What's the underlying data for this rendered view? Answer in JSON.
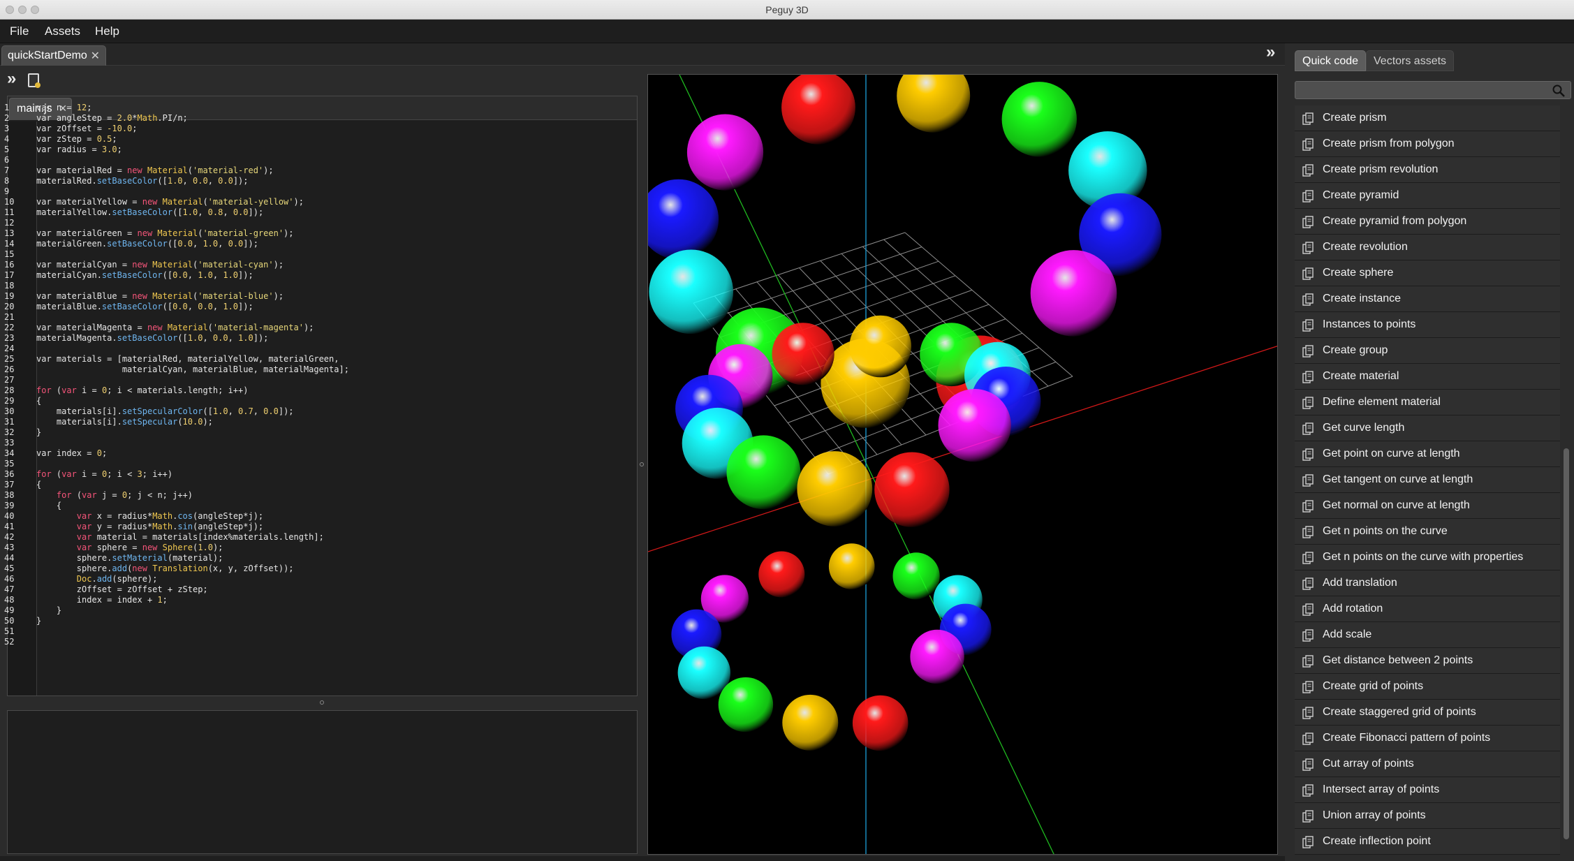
{
  "window": {
    "title": "Peguy 3D"
  },
  "menu": [
    "File",
    "Assets",
    "Help"
  ],
  "document_tab": {
    "label": "quickStartDemo",
    "close": "✕"
  },
  "editor": {
    "file_tab": {
      "label": "main.js",
      "close": "✕"
    },
    "line_count": 52,
    "lines": [
      [
        [
          "t",
          "var n = "
        ],
        [
          "n",
          "12"
        ],
        [
          "t",
          ";"
        ]
      ],
      [
        [
          "t",
          "var angleStep = "
        ],
        [
          "n",
          "2.0"
        ],
        [
          "t",
          "*"
        ],
        [
          "c",
          "Math"
        ],
        [
          "t",
          ".PI/n;"
        ]
      ],
      [
        [
          "t",
          "var zOffset = "
        ],
        [
          "n",
          "-10.0"
        ],
        [
          "t",
          ";"
        ]
      ],
      [
        [
          "t",
          "var zStep = "
        ],
        [
          "n",
          "0.5"
        ],
        [
          "t",
          ";"
        ]
      ],
      [
        [
          "t",
          "var radius = "
        ],
        [
          "n",
          "3.0"
        ],
        [
          "t",
          ";"
        ]
      ],
      [],
      [
        [
          "t",
          "var materialRed = "
        ],
        [
          "k",
          "new"
        ],
        [
          "t",
          " "
        ],
        [
          "c",
          "Material"
        ],
        [
          "t",
          "("
        ],
        [
          "s",
          "'material-red'"
        ],
        [
          "t",
          ");"
        ]
      ],
      [
        [
          "t",
          "materialRed."
        ],
        [
          "f",
          "setBaseColor"
        ],
        [
          "t",
          "(["
        ],
        [
          "n",
          "1.0"
        ],
        [
          "t",
          ", "
        ],
        [
          "n",
          "0.0"
        ],
        [
          "t",
          ", "
        ],
        [
          "n",
          "0.0"
        ],
        [
          "t",
          "]);"
        ]
      ],
      [],
      [
        [
          "t",
          "var materialYellow = "
        ],
        [
          "k",
          "new"
        ],
        [
          "t",
          " "
        ],
        [
          "c",
          "Material"
        ],
        [
          "t",
          "("
        ],
        [
          "s",
          "'material-yellow'"
        ],
        [
          "t",
          ");"
        ]
      ],
      [
        [
          "t",
          "materialYellow."
        ],
        [
          "f",
          "setBaseColor"
        ],
        [
          "t",
          "(["
        ],
        [
          "n",
          "1.0"
        ],
        [
          "t",
          ", "
        ],
        [
          "n",
          "0.8"
        ],
        [
          "t",
          ", "
        ],
        [
          "n",
          "0.0"
        ],
        [
          "t",
          "]);"
        ]
      ],
      [],
      [
        [
          "t",
          "var materialGreen = "
        ],
        [
          "k",
          "new"
        ],
        [
          "t",
          " "
        ],
        [
          "c",
          "Material"
        ],
        [
          "t",
          "("
        ],
        [
          "s",
          "'material-green'"
        ],
        [
          "t",
          ");"
        ]
      ],
      [
        [
          "t",
          "materialGreen."
        ],
        [
          "f",
          "setBaseColor"
        ],
        [
          "t",
          "(["
        ],
        [
          "n",
          "0.0"
        ],
        [
          "t",
          ", "
        ],
        [
          "n",
          "1.0"
        ],
        [
          "t",
          ", "
        ],
        [
          "n",
          "0.0"
        ],
        [
          "t",
          "]);"
        ]
      ],
      [],
      [
        [
          "t",
          "var materialCyan = "
        ],
        [
          "k",
          "new"
        ],
        [
          "t",
          " "
        ],
        [
          "c",
          "Material"
        ],
        [
          "t",
          "("
        ],
        [
          "s",
          "'material-cyan'"
        ],
        [
          "t",
          ");"
        ]
      ],
      [
        [
          "t",
          "materialCyan."
        ],
        [
          "f",
          "setBaseColor"
        ],
        [
          "t",
          "(["
        ],
        [
          "n",
          "0.0"
        ],
        [
          "t",
          ", "
        ],
        [
          "n",
          "1.0"
        ],
        [
          "t",
          ", "
        ],
        [
          "n",
          "1.0"
        ],
        [
          "t",
          "]);"
        ]
      ],
      [],
      [
        [
          "t",
          "var materialBlue = "
        ],
        [
          "k",
          "new"
        ],
        [
          "t",
          " "
        ],
        [
          "c",
          "Material"
        ],
        [
          "t",
          "("
        ],
        [
          "s",
          "'material-blue'"
        ],
        [
          "t",
          ");"
        ]
      ],
      [
        [
          "t",
          "materialBlue."
        ],
        [
          "f",
          "setBaseColor"
        ],
        [
          "t",
          "(["
        ],
        [
          "n",
          "0.0"
        ],
        [
          "t",
          ", "
        ],
        [
          "n",
          "0.0"
        ],
        [
          "t",
          ", "
        ],
        [
          "n",
          "1.0"
        ],
        [
          "t",
          "]);"
        ]
      ],
      [],
      [
        [
          "t",
          "var materialMagenta = "
        ],
        [
          "k",
          "new"
        ],
        [
          "t",
          " "
        ],
        [
          "c",
          "Material"
        ],
        [
          "t",
          "("
        ],
        [
          "s",
          "'material-magenta'"
        ],
        [
          "t",
          ");"
        ]
      ],
      [
        [
          "t",
          "materialMagenta."
        ],
        [
          "f",
          "setBaseColor"
        ],
        [
          "t",
          "(["
        ],
        [
          "n",
          "1.0"
        ],
        [
          "t",
          ", "
        ],
        [
          "n",
          "0.0"
        ],
        [
          "t",
          ", "
        ],
        [
          "n",
          "1.0"
        ],
        [
          "t",
          "]);"
        ]
      ],
      [],
      [
        [
          "t",
          "var materials = [materialRed, materialYellow, materialGreen,"
        ]
      ],
      [
        [
          "t",
          "                 materialCyan, materialBlue, materialMagenta];"
        ]
      ],
      [],
      [
        [
          "k",
          "for"
        ],
        [
          "t",
          " ("
        ],
        [
          "k",
          "var"
        ],
        [
          "t",
          " i = "
        ],
        [
          "n",
          "0"
        ],
        [
          "t",
          "; i < materials.length; i++)"
        ]
      ],
      [
        [
          "t",
          "{"
        ]
      ],
      [
        [
          "t",
          "    materials[i]."
        ],
        [
          "f",
          "setSpecularColor"
        ],
        [
          "t",
          "(["
        ],
        [
          "n",
          "1.0"
        ],
        [
          "t",
          ", "
        ],
        [
          "n",
          "0.7"
        ],
        [
          "t",
          ", "
        ],
        [
          "n",
          "0.0"
        ],
        [
          "t",
          "]);"
        ]
      ],
      [
        [
          "t",
          "    materials[i]."
        ],
        [
          "f",
          "setSpecular"
        ],
        [
          "t",
          "("
        ],
        [
          "n",
          "10.0"
        ],
        [
          "t",
          ");"
        ]
      ],
      [
        [
          "t",
          "}"
        ]
      ],
      [],
      [
        [
          "t",
          "var index = "
        ],
        [
          "n",
          "0"
        ],
        [
          "t",
          ";"
        ]
      ],
      [],
      [
        [
          "k",
          "for"
        ],
        [
          "t",
          " ("
        ],
        [
          "k",
          "var"
        ],
        [
          "t",
          " i = "
        ],
        [
          "n",
          "0"
        ],
        [
          "t",
          "; i < "
        ],
        [
          "n",
          "3"
        ],
        [
          "t",
          "; i++)"
        ]
      ],
      [
        [
          "t",
          "{"
        ]
      ],
      [
        [
          "t",
          "    "
        ],
        [
          "k",
          "for"
        ],
        [
          "t",
          " ("
        ],
        [
          "k",
          "var"
        ],
        [
          "t",
          " j = "
        ],
        [
          "n",
          "0"
        ],
        [
          "t",
          "; j < n; j++)"
        ]
      ],
      [
        [
          "t",
          "    {"
        ]
      ],
      [
        [
          "t",
          "        "
        ],
        [
          "k",
          "var"
        ],
        [
          "t",
          " x = radius*"
        ],
        [
          "c",
          "Math"
        ],
        [
          "t",
          "."
        ],
        [
          "f",
          "cos"
        ],
        [
          "t",
          "(angleStep*j);"
        ]
      ],
      [
        [
          "t",
          "        "
        ],
        [
          "k",
          "var"
        ],
        [
          "t",
          " y = radius*"
        ],
        [
          "c",
          "Math"
        ],
        [
          "t",
          "."
        ],
        [
          "f",
          "sin"
        ],
        [
          "t",
          "(angleStep*j);"
        ]
      ],
      [
        [
          "t",
          "        "
        ],
        [
          "k",
          "var"
        ],
        [
          "t",
          " material = materials[index%materials.length];"
        ]
      ],
      [
        [
          "t",
          "        "
        ],
        [
          "k",
          "var"
        ],
        [
          "t",
          " sphere = "
        ],
        [
          "k",
          "new"
        ],
        [
          "t",
          " "
        ],
        [
          "c",
          "Sphere"
        ],
        [
          "t",
          "("
        ],
        [
          "n",
          "1.0"
        ],
        [
          "t",
          ");"
        ]
      ],
      [
        [
          "t",
          "        sphere."
        ],
        [
          "f",
          "setMaterial"
        ],
        [
          "t",
          "(material);"
        ]
      ],
      [
        [
          "t",
          "        sphere."
        ],
        [
          "f",
          "add"
        ],
        [
          "t",
          "("
        ],
        [
          "k",
          "new"
        ],
        [
          "t",
          " "
        ],
        [
          "c",
          "Translation"
        ],
        [
          "t",
          "(x, y, zOffset));"
        ]
      ],
      [
        [
          "t",
          "        "
        ],
        [
          "c",
          "Doc"
        ],
        [
          "t",
          "."
        ],
        [
          "f",
          "add"
        ],
        [
          "t",
          "(sphere);"
        ]
      ],
      [
        [
          "t",
          "        zOffset = zOffset + zStep;"
        ]
      ],
      [
        [
          "t",
          "        index = index + "
        ],
        [
          "n",
          "1"
        ],
        [
          "t",
          ";"
        ]
      ],
      [
        [
          "t",
          "    }"
        ]
      ],
      [
        [
          "t",
          "}"
        ]
      ],
      [],
      []
    ]
  },
  "side_panel": {
    "tabs": [
      "Quick code",
      "Vectors assets"
    ],
    "search": {
      "value": "",
      "placeholder": ""
    },
    "snippets": [
      "Create prism",
      "Create prism from polygon",
      "Create prism revolution",
      "Create pyramid",
      "Create pyramid from polygon",
      "Create revolution",
      "Create sphere",
      "Create instance",
      "Instances to points",
      "Create group",
      "Create material",
      "Define element material",
      "Get curve length",
      "Get point on curve at length",
      "Get tangent on curve at length",
      "Get normal on curve at length",
      "Get n points on the curve",
      "Get n points on the curve with properties",
      "Add translation",
      "Add rotation",
      "Add scale",
      "Get distance between 2 points",
      "Create grid of points",
      "Create staggered grid of points",
      "Create Fibonacci pattern of points",
      "Cut array of points",
      "Intersect array of points",
      "Union array of points",
      "Create inflection point"
    ]
  },
  "scene": {
    "materials": {
      "red": "#ff1a1a",
      "yellow": "#ffcc00",
      "green": "#1aff1a",
      "cyan": "#1affff",
      "blue": "#1a1aff",
      "magenta": "#ff1aff"
    },
    "sphere_order": [
      "red",
      "yellow",
      "green",
      "cyan",
      "blue",
      "magenta"
    ],
    "sphere_count": 36,
    "axis_colors": {
      "x": "#d01818",
      "y": "#1fb81f",
      "z": "#1b9fd8"
    },
    "grid_color": "#8c8c8c",
    "background": "#000000"
  }
}
